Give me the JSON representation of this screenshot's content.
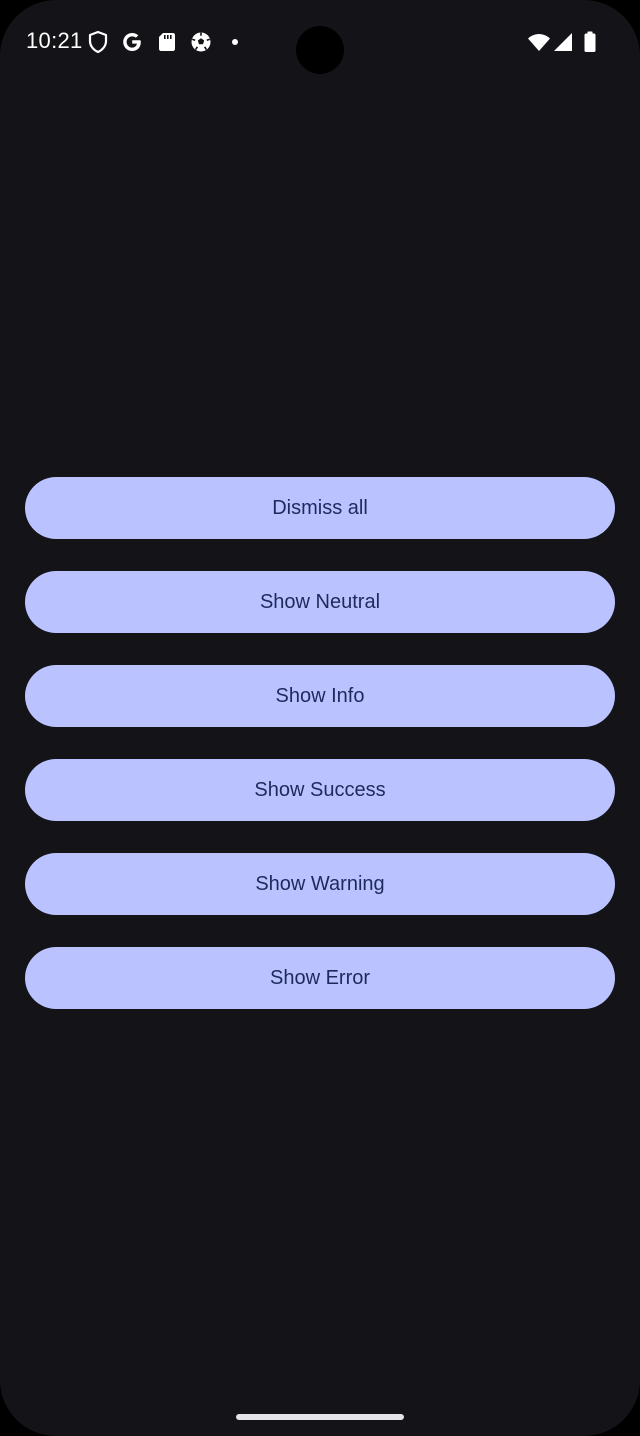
{
  "status_bar": {
    "time": "10:21",
    "left_icons": [
      "shield-icon",
      "google-icon",
      "sd-card-icon",
      "soccer-ball-icon",
      "notification-dot-icon"
    ],
    "right_icons": [
      "wifi-icon",
      "cellular-signal-icon",
      "battery-icon"
    ]
  },
  "colors": {
    "background": "#141318",
    "button_fill": "#bac3ff",
    "button_text": "#1f2a5c"
  },
  "buttons": [
    {
      "label": "Dismiss all"
    },
    {
      "label": "Show Neutral"
    },
    {
      "label": "Show Info"
    },
    {
      "label": "Show Success"
    },
    {
      "label": "Show Warning"
    },
    {
      "label": "Show Error"
    }
  ]
}
